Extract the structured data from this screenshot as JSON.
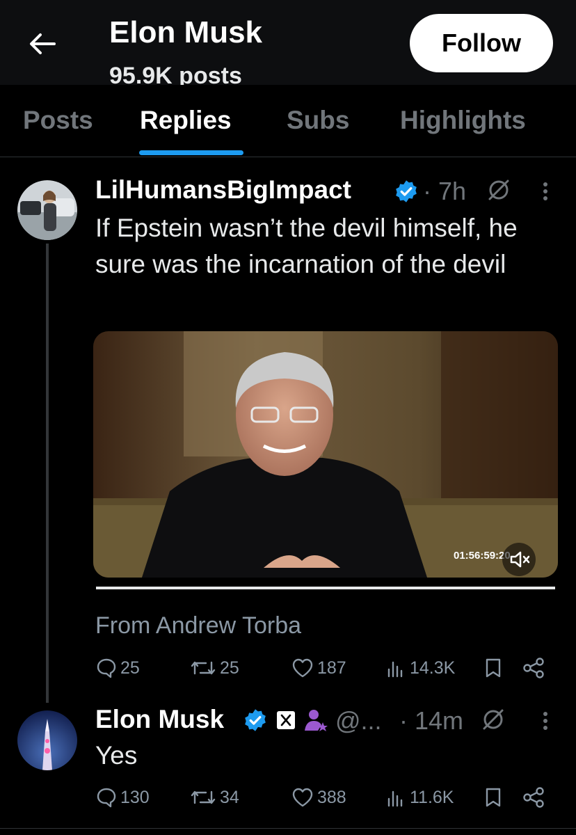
{
  "header": {
    "title": "Elon Musk",
    "post_count": "95.9K posts",
    "follow_label": "Follow"
  },
  "tabs": [
    {
      "label": "Posts"
    },
    {
      "label": "Replies"
    },
    {
      "label": "Subs"
    },
    {
      "label": "Highlights"
    }
  ],
  "active_tab": "Replies",
  "tweets": [
    {
      "author": "LilHumansBigImpact",
      "verified": true,
      "time": "· 7h",
      "text": "If Epstein wasn’t the devil himself, he sure was the incarnation of the devil",
      "media": {
        "timecode": "01:56:59:20"
      },
      "source": "From Andrew Torba",
      "stats": {
        "replies": "25",
        "reposts": "25",
        "likes": "187",
        "views": "14.3K"
      }
    },
    {
      "author": "Elon Musk",
      "verified": true,
      "handle": "@...",
      "time": "· 14m",
      "text": "Yes",
      "stats": {
        "replies": "130",
        "reposts": "34",
        "likes": "388",
        "views": "11.6K"
      }
    }
  ],
  "colors": {
    "accent": "#1d9bf0",
    "background": "#000000",
    "muted": "#71767b"
  }
}
